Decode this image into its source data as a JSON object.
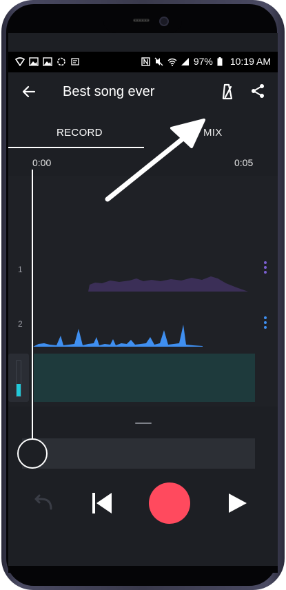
{
  "status_bar": {
    "battery": "97%",
    "time": "10:19 AM",
    "left_icons": [
      "wifi-shield-icon",
      "image-icon",
      "image-icon",
      "sync-icon",
      "app-icon"
    ],
    "right_icons": [
      "nfc-icon",
      "mute-icon",
      "wifi-icon",
      "signal-icon",
      "battery-icon"
    ]
  },
  "app_bar": {
    "title": "Best song ever",
    "back_icon": "arrow-left-icon",
    "metronome_icon": "metronome-icon",
    "share_icon": "share-icon"
  },
  "tabs": [
    {
      "label": "RECORD",
      "selected": true
    },
    {
      "label": "MIX",
      "selected": false
    }
  ],
  "timeline": {
    "start": "0:00",
    "end": "0:05"
  },
  "tracks": [
    {
      "number": "1",
      "color": "#3b2f57",
      "menu_color": "#7a5fd0"
    },
    {
      "number": "2",
      "color": "#3f8ff0",
      "menu_color": "#3f8ff0"
    }
  ],
  "record_track_color": "#1e3a3c",
  "level_meter_color": "#21c9d9",
  "controls": {
    "undo_icon": "undo-icon",
    "previous_icon": "skip-previous-icon",
    "record_icon": "record-button-icon",
    "play_icon": "play-icon",
    "record_color": "#ff4a5e"
  },
  "annotation": {
    "arrow_icon": "annotation-arrow-icon"
  }
}
